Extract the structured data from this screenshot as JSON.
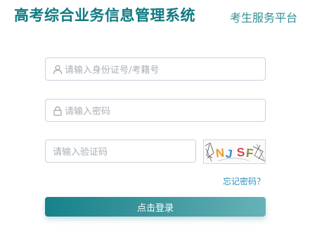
{
  "header": {
    "title": "高考综合业务信息管理系统",
    "subtitle": "考生服务平台"
  },
  "form": {
    "username_placeholder": "请输入身份证号/考籍号",
    "password_placeholder": "请输入密码",
    "captcha_placeholder": "请输入验证码",
    "captcha_text": "NJSF",
    "captcha_chars": [
      "N",
      "J",
      "S",
      "F"
    ],
    "forgot_password_label": "忘记密码？",
    "login_label": "点击登录",
    "username_icon": "user-icon",
    "password_icon": "lock-icon"
  },
  "colors": {
    "brand": "#0f7a82",
    "link": "#2e8fb8",
    "button_start": "#16828a",
    "button_end": "#66b3b8",
    "placeholder": "#a9b0b8"
  }
}
